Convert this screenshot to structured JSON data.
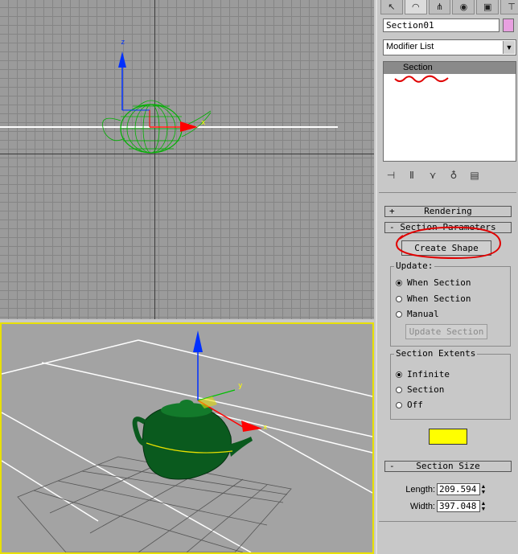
{
  "viewport_top": {
    "axis_z_label": "z",
    "axis_x_label": "x"
  },
  "viewport_perspective": {
    "axis_x_label": "x",
    "axis_y_label": "y"
  },
  "command_panel": {
    "tabs": [
      {
        "name": "create-tab",
        "icon": "cursor-icon"
      },
      {
        "name": "modify-tab",
        "icon": "bend-icon"
      },
      {
        "name": "hierarchy-tab",
        "icon": "hierarchy-icon"
      },
      {
        "name": "motion-tab",
        "icon": "motion-icon"
      },
      {
        "name": "display-tab",
        "icon": "display-icon"
      },
      {
        "name": "utilities-tab",
        "icon": "hammer-icon"
      }
    ],
    "object_name": "Section01",
    "object_color": "#e8a0e0",
    "modifier_list_label": "Modifier List",
    "stack_items": [
      "Section"
    ],
    "rendering_rollout": {
      "sign": "+",
      "title": "Rendering"
    },
    "section_params_rollout": {
      "sign": "-",
      "title": "Section Parameters"
    },
    "create_shape_label": "Create Shape",
    "update_group": {
      "label": "Update:",
      "options": [
        "When Section",
        "When Section",
        "Manual"
      ],
      "selected": 0,
      "update_button_label": "Update Section"
    },
    "extents_group": {
      "label": "Section Extents",
      "options": [
        "Infinite",
        "Section",
        "Off"
      ],
      "selected": 0
    },
    "section_color": "#ffff00",
    "section_size_rollout": {
      "sign": "-",
      "title": "Section Size"
    },
    "length_label": "Length:",
    "length_value": "209.594",
    "width_label": "Width:",
    "width_value": "397.048"
  }
}
